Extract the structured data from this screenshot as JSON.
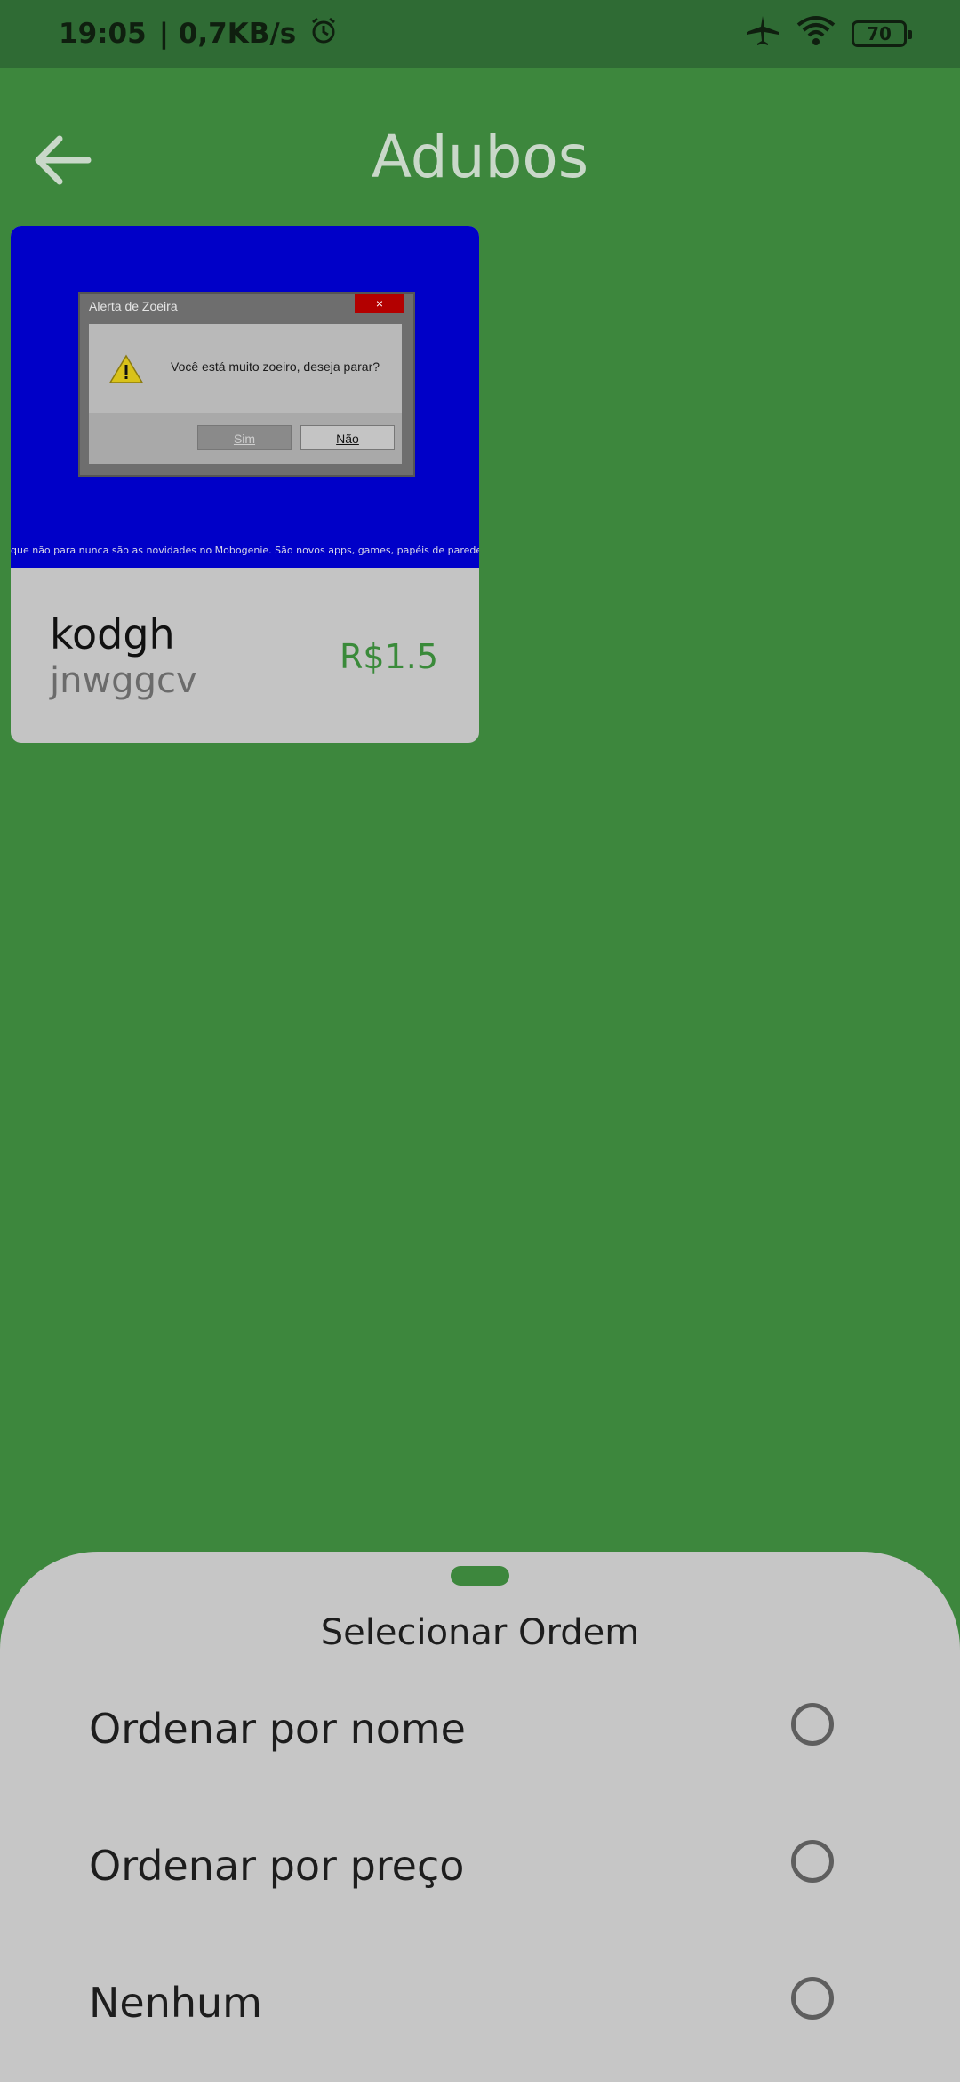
{
  "status_bar": {
    "time": "19:05",
    "speed": "| 0,7KB/s",
    "battery": "70"
  },
  "header": {
    "title": "Adubos"
  },
  "products": [
    {
      "name": "kodgh",
      "subtitle": "jnwggcv",
      "price": "R$1.5",
      "image": {
        "window_title": "Alerta de Zoeira",
        "close_label": "×",
        "message": "Você está muito zoeiro, deseja parar?",
        "yes_label": "Sim",
        "no_label": "Não",
        "ticker": "que não para nunca são as novidades no Mobogenie. São novos apps, games, papéis de parede e música todo dia!"
      }
    }
  ],
  "sort_sheet": {
    "title": "Selecionar Ordem",
    "options": [
      {
        "label": "Ordenar por nome",
        "selected": false
      },
      {
        "label": "Ordenar por preço",
        "selected": false
      },
      {
        "label": "Nenhum",
        "selected": false
      }
    ]
  },
  "colors": {
    "app_green": "#3d873d",
    "status_bar": "#2f6b34",
    "sheet_bg": "#c6c6c6",
    "price_green": "#3a8a3a"
  }
}
